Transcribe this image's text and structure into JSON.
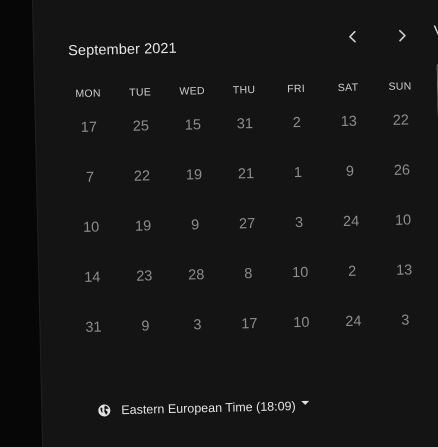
{
  "calendar": {
    "month_label": "September 2021",
    "weekdays": [
      "MON",
      "TUE",
      "WED",
      "THU",
      "FRI",
      "SAT",
      "SUN"
    ],
    "weeks": [
      [
        "17",
        "25",
        "15",
        "31",
        "2",
        "13",
        "22"
      ],
      [
        "7",
        "22",
        "19",
        "21",
        "1",
        "9",
        "26"
      ],
      [
        "10",
        "19",
        "9",
        "27",
        "3",
        "24",
        "10"
      ],
      [
        "14",
        "23",
        "28",
        "8",
        "10",
        "2",
        "13"
      ],
      [
        "31",
        "9",
        "3",
        "17",
        "10",
        "24",
        "3"
      ]
    ]
  },
  "navigation": {
    "prev_icon": "chevron-left-icon",
    "next_icon": "chevron-right-icon"
  },
  "side_pane": {
    "partial_heading": "V"
  },
  "timezone": {
    "icon": "globe-icon",
    "label": "Eastern European Time (18:09)"
  },
  "colors": {
    "background": "#060606",
    "panel": "#141414",
    "day_text": "#8d8d8d",
    "heading_text": "#e6e6e6"
  }
}
